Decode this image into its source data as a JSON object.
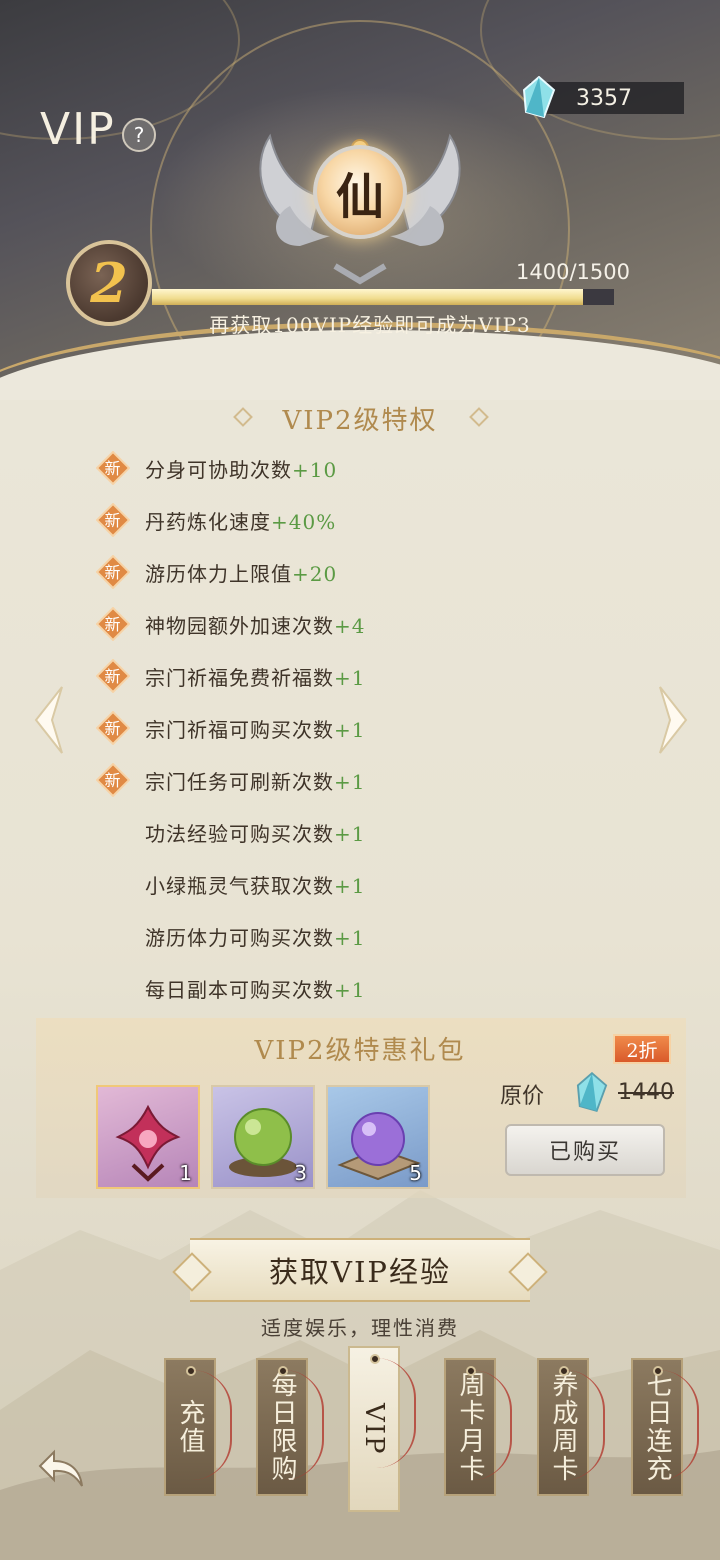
{
  "header": {
    "title": "VIP",
    "help_icon": "?",
    "emblem_char": "仙",
    "currency_amount": "3357",
    "level": "2",
    "exp_text": "1400/1500",
    "exp_progress": 0.933,
    "exp_hint": "再获取100VIP经验即可成为VIP3"
  },
  "privileges": {
    "title": "VIP2级特权",
    "items": [
      {
        "label": "分身可协助次数",
        "bonus": "+10",
        "new": true
      },
      {
        "label": "丹药炼化速度",
        "bonus": "+40%",
        "new": true
      },
      {
        "label": "游历体力上限值",
        "bonus": "+20",
        "new": true
      },
      {
        "label": "神物园额外加速次数",
        "bonus": "+4",
        "new": true
      },
      {
        "label": "宗门祈福免费祈福数",
        "bonus": "+1",
        "new": true
      },
      {
        "label": "宗门祈福可购买次数",
        "bonus": "+1",
        "new": true
      },
      {
        "label": "宗门任务可刷新次数",
        "bonus": "+1",
        "new": true
      },
      {
        "label": "功法经验可购买次数",
        "bonus": "+1",
        "new": false
      },
      {
        "label": "小绿瓶灵气获取次数",
        "bonus": "+1",
        "new": false
      },
      {
        "label": "游历体力可购买次数",
        "bonus": "+1",
        "new": false
      },
      {
        "label": "每日副本可购买次数",
        "bonus": "+1",
        "new": false
      }
    ],
    "new_tag": "新"
  },
  "gift": {
    "title": "VIP2级特惠礼包",
    "discount": "2折",
    "items": [
      {
        "name": "lotus-artifact",
        "count": "1"
      },
      {
        "name": "green-orb",
        "count": "3"
      },
      {
        "name": "purple-orb",
        "count": "5"
      }
    ],
    "orig_label": "原价",
    "orig_price": "1440",
    "bought_label": "已购买"
  },
  "get_exp": {
    "button_label": "获取VIP经验",
    "moderation": "适度娱乐，理性消费"
  },
  "tabs": [
    {
      "label": "充值",
      "active": false
    },
    {
      "label": "每日限购",
      "active": false
    },
    {
      "label": "VIP",
      "active": true
    },
    {
      "label": "周卡月卡",
      "active": false
    },
    {
      "label": "养成周卡",
      "active": false
    },
    {
      "label": "七日连充",
      "active": false
    }
  ],
  "colors": {
    "gold": "#b08a4e",
    "bonus_green": "#5b9a44",
    "exp_bar_fill": "#f0dc8e",
    "discount_orange": "#e06a30"
  }
}
